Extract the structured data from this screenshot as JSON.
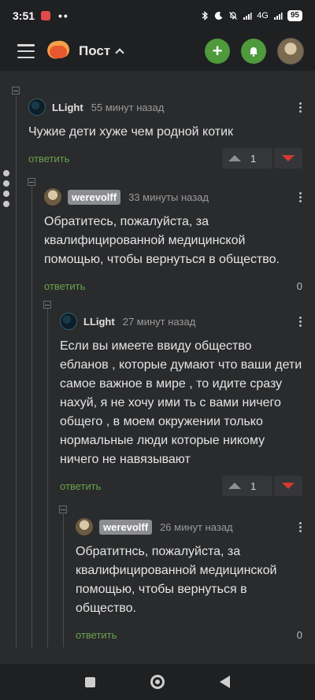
{
  "statusbar": {
    "time": "3:51",
    "dots": "••",
    "network": "4G",
    "battery": "95"
  },
  "header": {
    "title": "Пост",
    "add_button": "+"
  },
  "comments": [
    {
      "author": "LLight",
      "time": "55 минут назад",
      "text": "Чужие дети хуже чем родной котик",
      "reply": "ответить",
      "votes": "1"
    },
    {
      "author": "werevolff",
      "time": "33 минуты назад",
      "text": "Обратитесь, пожалуйста, за квалифицированной медицинской помощью, чтобы вернуться в общество.",
      "reply": "ответить",
      "votes": "0"
    },
    {
      "author": "LLight",
      "time": "27 минут назад",
      "text": "Если вы имеете ввиду общество ебланов , которые думают что ваши дети самое важное в мире , то идите сразу нахуй, я не хочу ими ть с вами ничего общего , в моем окружении только нормальные люди которые никому ничего не навязывают",
      "reply": "ответить",
      "votes": "1"
    },
    {
      "author": "werevolff",
      "time": "26 минут назад",
      "text": "Обратитнсь, пожалуйста, за квалифицированной медицинской помощью, чтобы вернуться в общество.",
      "reply": "ответить",
      "votes": "0"
    }
  ],
  "colors": {
    "accent_green": "#4e9a3d",
    "reply_green": "#6aa24e",
    "downvote_red": "#d5392f"
  },
  "icons": [
    "hamburger-icon",
    "logo-icon",
    "chevron-up-icon",
    "plus-icon",
    "bell-icon",
    "kebab-icon",
    "upvote-icon",
    "downvote-icon"
  ]
}
